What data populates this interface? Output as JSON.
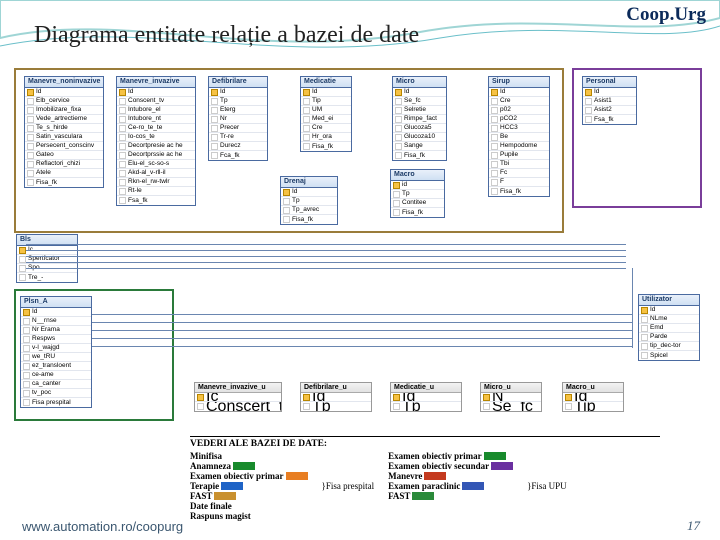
{
  "header": {
    "app": "Coop.Urg",
    "title": "Diagrama entitate relație a bazei de date",
    "url": "www.automation.ro/coopurg",
    "page": "17"
  },
  "entities": {
    "manevre_noninvazive": {
      "title": "Manevre_noninvazive",
      "fields": [
        "Id",
        "Elb_cervice",
        "Imobilizare_fixa",
        "Vede_artrectieme",
        "Te_s_hirde",
        "Satin_vasculara",
        "Persecent_conscinv",
        "Gateo",
        "Reflactori_chizi",
        "Atele",
        "Fisa_fk"
      ]
    },
    "manevre_invazive": {
      "title": "Manevre_invazive",
      "fields": [
        "Id",
        "Conscent_tv",
        "Intubore_el",
        "Intubore_nt",
        "Ce-ro_te_te",
        "Io-cos_te",
        "Decortpresie ac he",
        "Decortprssie ac he",
        "Elu-el_sc-so-s",
        "Akd-al_v-rll-il",
        "Rkn-el_rw-twlr",
        "Rt-le",
        "Fsa_fk"
      ]
    },
    "defibrilare": {
      "title": "Defibrilare",
      "fields": [
        "Id",
        "Tp",
        "Eterg",
        "Nr",
        "Precer",
        "Tr-re",
        "Durecz",
        "Fca_fk"
      ]
    },
    "medicatie": {
      "title": "Medicatie",
      "fields": [
        "Id",
        "Tip",
        "UM",
        "Med_ei",
        "Cre",
        "Hr_ora",
        "Fisa_fk"
      ]
    },
    "micro": {
      "title": "Micro",
      "fields": [
        "Id",
        "Se_fc",
        "Selretie",
        "Rimpe_fact",
        "Glucoza5",
        "Glucoza10",
        "Sange",
        "Fisa_fk"
      ]
    },
    "macro": {
      "title": "Macro",
      "fields": [
        "id",
        "Tp",
        "Contitee",
        "Fisa_fk"
      ]
    },
    "sirup": {
      "title": "Sirup",
      "fields": [
        "Id",
        "Cre",
        "p02",
        "pCO2",
        "HCC3",
        "Be",
        "Hempodome",
        "Pupile",
        "Tbi",
        "Fc",
        "F",
        "Fisa_fk"
      ]
    },
    "personal": {
      "title": "Personal",
      "fields": [
        "Id",
        "Asist1",
        "Asist2",
        "Fsa_fk"
      ]
    },
    "bls": {
      "title": "Bls",
      "fields": [
        "Ic",
        "Spertfcator",
        "Spo",
        "Tre_-"
      ]
    },
    "plsn_a": {
      "title": "Plsn_A",
      "fields": [
        "Id",
        "N__rnse",
        "Nr Erama",
        "Respws",
        "v-l_wajgd",
        "we_tRU",
        "ez_transloent",
        "ce-ame",
        "ca_canter",
        "tv_poc",
        "Fisa prespital"
      ]
    },
    "drenaj": {
      "title": "Drenaj",
      "fields": [
        "Id",
        "Tp",
        "Tp_avrec",
        "Fisa_fk"
      ]
    },
    "utilizator": {
      "title": "Utilizator",
      "fields": [
        "Id",
        "NLme",
        "Emd",
        "Parde",
        "tip_dec-tor",
        "Spicel"
      ]
    },
    "man_inv_u": {
      "title": "Manevre_invazive_u",
      "fields": [
        "Ic",
        "Conscert_tw"
      ]
    },
    "defib_u": {
      "title": "Defibrilare_u",
      "fields": [
        "Id",
        "Tp"
      ]
    },
    "medic_u": {
      "title": "Medicatie_u",
      "fields": [
        "Id",
        "Tp"
      ]
    },
    "micro_u": {
      "title": "Micro_u",
      "fields": [
        "N",
        "Se_fc"
      ]
    },
    "macro_u": {
      "title": "Macro_u",
      "fields": [
        "Id",
        "Tip"
      ]
    }
  },
  "legend": {
    "title": "VEDERI ALE BAZEI DE DATE:",
    "col1": [
      {
        "t": "Minifisa",
        "c": ""
      },
      {
        "t": "Anamneza",
        "c": "#188a2c"
      },
      {
        "t": "Examen obiectiv primar",
        "c": "#e87e22"
      },
      {
        "t": "Terapie",
        "c": "#1e63c6"
      },
      {
        "t": "FAST",
        "c": "#c9902e"
      },
      {
        "t": "Date finale",
        "c": ""
      },
      {
        "t": "Raspuns magist",
        "c": ""
      }
    ],
    "col2_label": "Fisa prespital",
    "col2": [
      {
        "t": "Examen obiectiv primar",
        "c": "#188a2c"
      },
      {
        "t": "Examen obiectiv secundar",
        "c": "#6a2fa0"
      },
      {
        "t": "Manevre",
        "c": "#c43a1f"
      },
      {
        "t": "Examen paraclinic",
        "c": "#3356b5"
      },
      {
        "t": "FAST",
        "c": "#2a8a3a"
      }
    ],
    "col3_label": "Fisa UPU"
  }
}
